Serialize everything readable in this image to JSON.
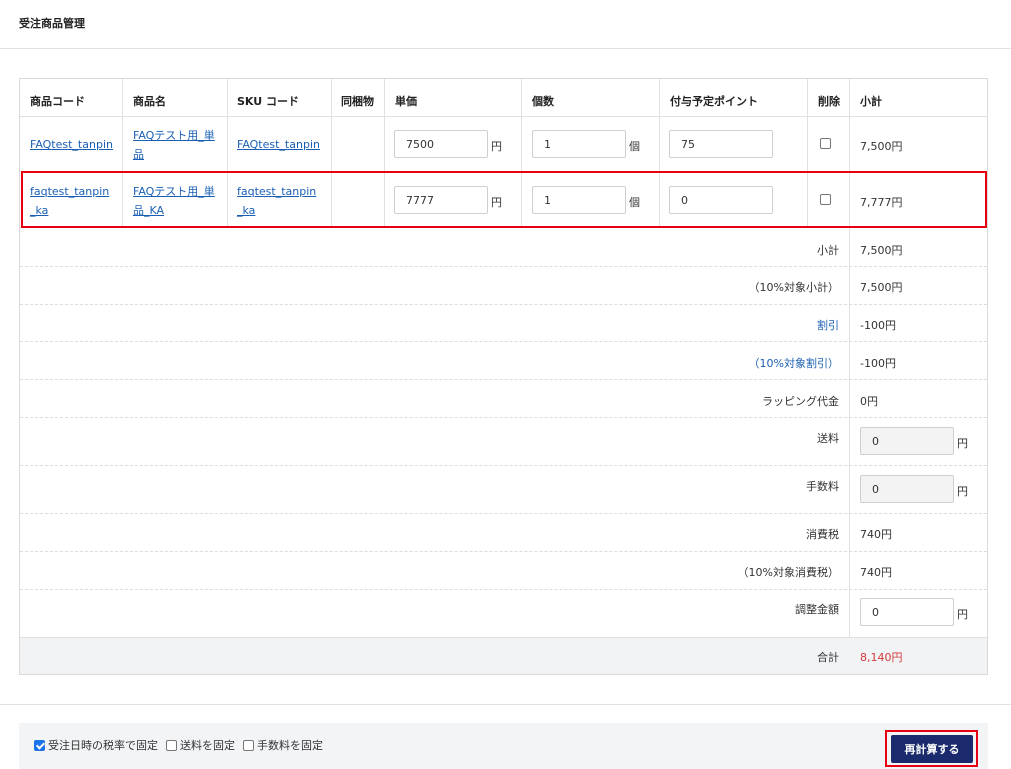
{
  "header": {
    "title": "受注商品管理"
  },
  "table": {
    "columns": [
      "商品コード",
      "商品名",
      "SKU コード",
      "同梱物",
      "単価",
      "個数",
      "付与予定ポイント",
      "削除",
      "小計"
    ],
    "rows": [
      {
        "code": [
          "FAQtest_tanpin"
        ],
        "name": [
          "FAQテスト用_単",
          "品"
        ],
        "sku": [
          "FAQtest_tanpin"
        ],
        "price": "7500",
        "price_unit": "円",
        "qty": "1",
        "qty_unit": "個",
        "points": "75",
        "delete_checked": false,
        "subtotal": "7,500円"
      },
      {
        "code": [
          "faqtest_tanpin",
          "_ka"
        ],
        "name": [
          "FAQテスト用_単",
          "品_KA"
        ],
        "sku": [
          "faqtest_tanpin",
          "_ka"
        ],
        "price": "7777",
        "price_unit": "円",
        "qty": "1",
        "qty_unit": "個",
        "points": "0",
        "delete_checked": false,
        "subtotal": "7,777円"
      }
    ]
  },
  "summary": {
    "subtotal": {
      "label": "小計",
      "value": "7,500円"
    },
    "subtotal10": {
      "label": "（10%対象小計）",
      "value": "7,500円"
    },
    "discount": {
      "label": "割引",
      "value": "-100円"
    },
    "discount10": {
      "label": "（10%対象割引）",
      "value": "-100円"
    },
    "wrapping": {
      "label": "ラッピング代金",
      "value": "0円"
    },
    "shipping": {
      "label": "送料",
      "value": "0",
      "unit": "円"
    },
    "fee": {
      "label": "手数料",
      "value": "0",
      "unit": "円"
    },
    "tax": {
      "label": "消費税",
      "value": "740円"
    },
    "tax10": {
      "label": "（10%対象消費税）",
      "value": "740円"
    },
    "adjust": {
      "label": "調整金額",
      "value": "0",
      "unit": "円"
    },
    "total": {
      "label": "合計",
      "value": "8,140円"
    }
  },
  "footer": {
    "options": [
      {
        "label": "受注日時の税率で固定",
        "checked": true
      },
      {
        "label": "送料を固定",
        "checked": false
      },
      {
        "label": "手数料を固定",
        "checked": false
      }
    ],
    "recalc_label": "再計算する"
  },
  "colors": {
    "link": "#1a5fb4",
    "total_red": "#d63a3a",
    "button_navy": "#1a2a6c",
    "highlight_red": "#e60012"
  }
}
